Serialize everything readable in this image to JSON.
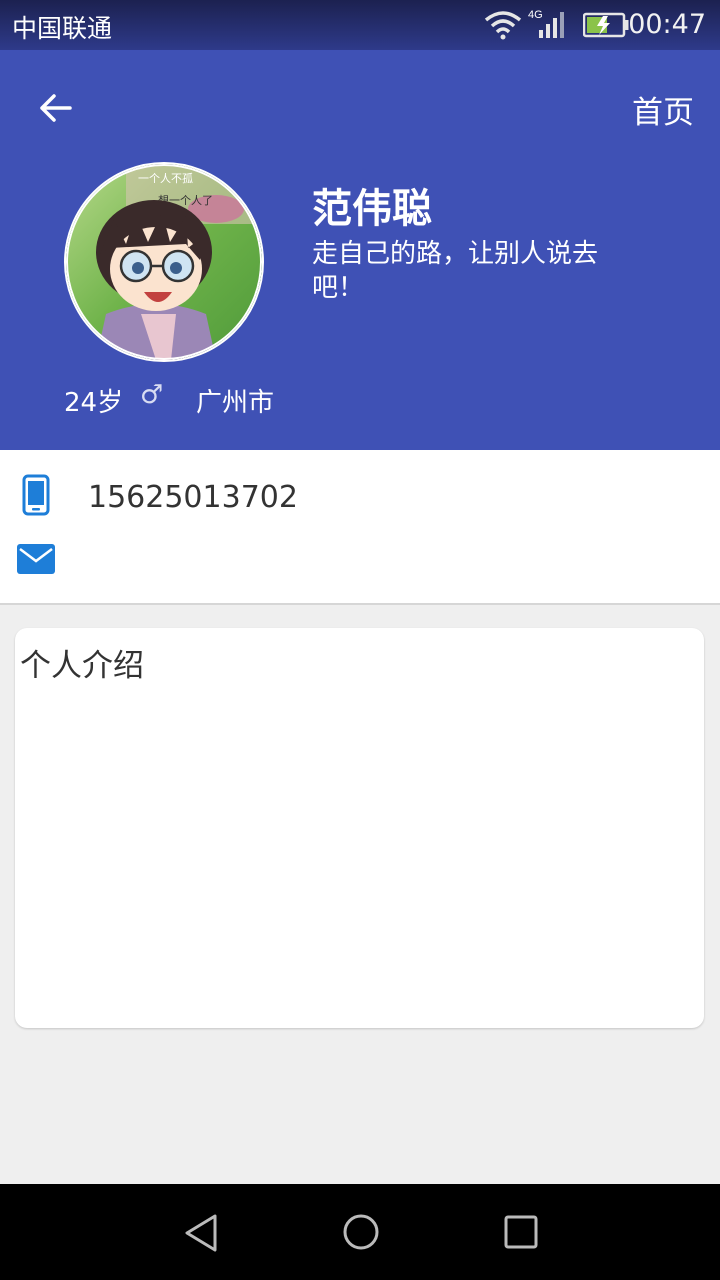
{
  "status_bar": {
    "carrier": "中国联通",
    "network": "4G",
    "time": "00:47"
  },
  "header": {
    "home_label": "首页",
    "name": "范伟聪",
    "motto": "走自己的路，让别人说去吧！",
    "age": "24岁",
    "gender_symbol": "♂",
    "city": "广州市"
  },
  "contact": {
    "phone": "15625013702",
    "email": ""
  },
  "intro": {
    "title": "个人介绍",
    "body": ""
  },
  "avatar_texts": [
    "一个人不孤",
    "想一个人了"
  ],
  "colors": {
    "primary": "#3f51b5",
    "icon_blue": "#1e7ed8",
    "background": "#efefef"
  },
  "icons": [
    "back-arrow-icon",
    "phone-icon",
    "mail-icon",
    "wifi-icon",
    "signal-icon",
    "battery-icon"
  ]
}
